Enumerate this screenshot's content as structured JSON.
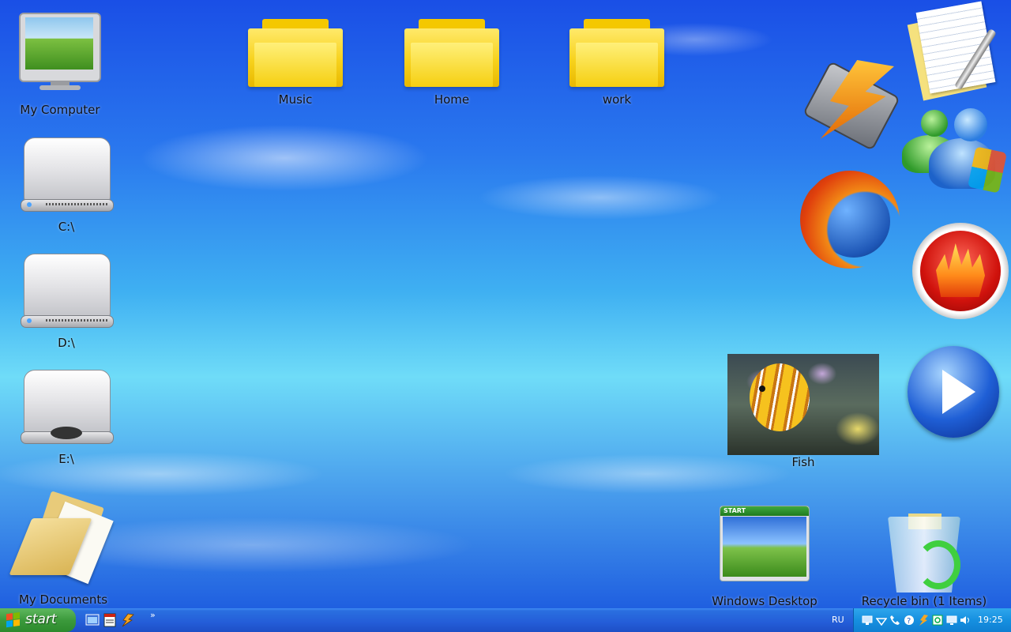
{
  "desktop": {
    "icons": {
      "my_computer": "My Computer",
      "c_drive": "C:\\",
      "d_drive": "D:\\",
      "e_drive": "E:\\",
      "my_documents": "My Documents",
      "music": "Music",
      "home": "Home",
      "work": "work",
      "fish": "Fish",
      "windows_desktop": "Windows Desktop",
      "recycle_bin": "Recycle bin (1 Items)"
    },
    "app_icons": [
      "winamp-icon",
      "notes-icon",
      "msn-messenger-icon",
      "firefox-icon",
      "burning-app-icon",
      "media-player-icon"
    ]
  },
  "taskbar": {
    "start_label": "start",
    "quick_launch": [
      "show-desktop-icon",
      "notepad-icon",
      "winamp-small-icon"
    ],
    "language": "RU",
    "tray_icons": [
      "network-icon",
      "wifi-icon",
      "phone-icon",
      "help-icon",
      "winamp-tray-icon",
      "sync-icon",
      "monitor-icon",
      "volume-icon"
    ],
    "clock": "19:25"
  },
  "colors": {
    "taskbar": "#245dd8",
    "start_button": "#3c9a3c",
    "tray": "#1690e0",
    "sky_top": "#1a4fe6",
    "sky_mid": "#6fdcf8"
  }
}
